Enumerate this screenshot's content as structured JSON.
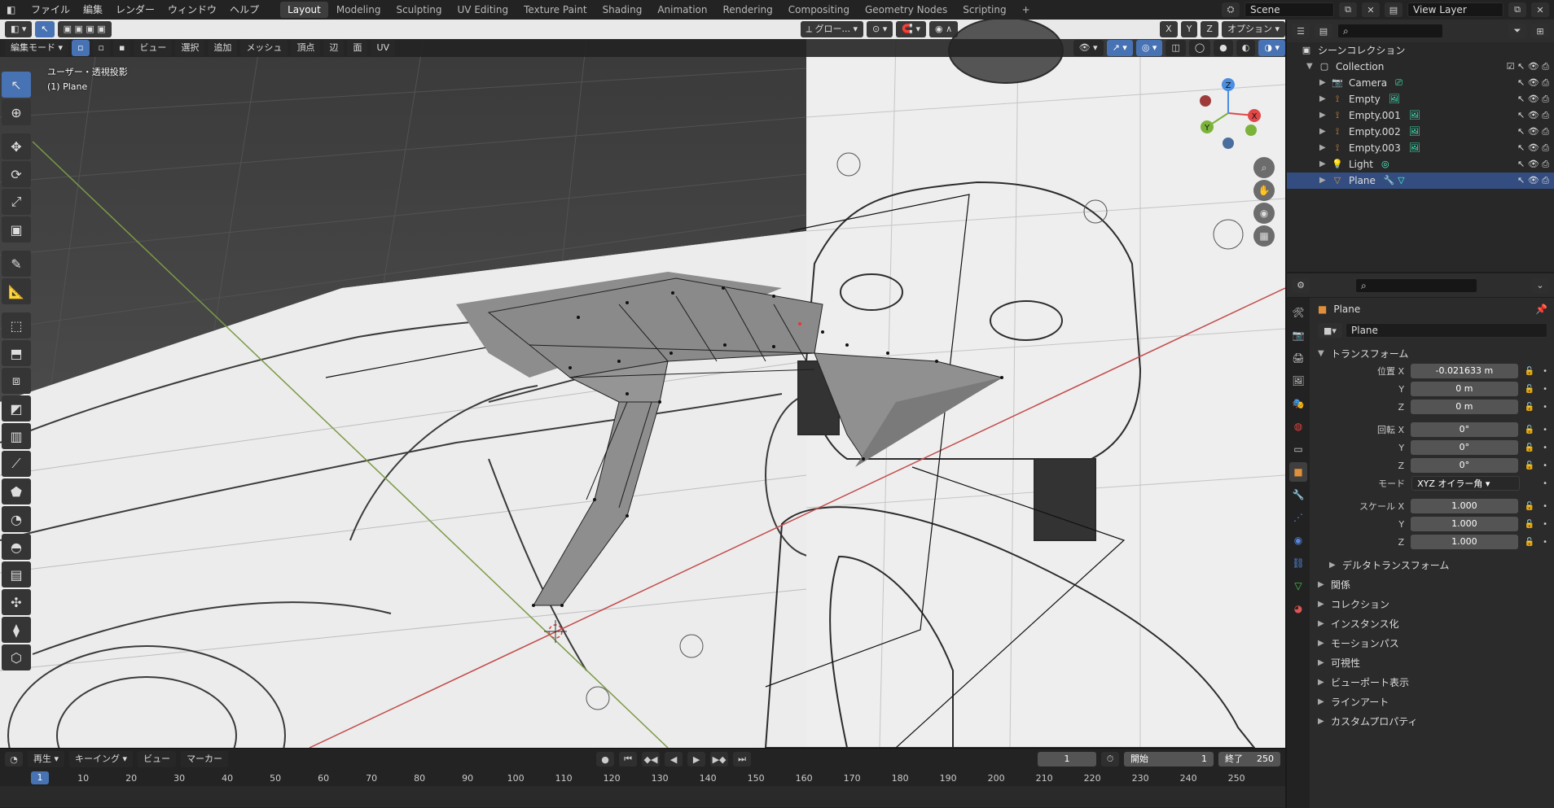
{
  "menubar": {
    "items": [
      "ファイル",
      "編集",
      "レンダー",
      "ウィンドウ",
      "ヘルプ"
    ],
    "workspaces": [
      "Layout",
      "Modeling",
      "Sculpting",
      "UV Editing",
      "Texture Paint",
      "Shading",
      "Animation",
      "Rendering",
      "Compositing",
      "Geometry Nodes",
      "Scripting"
    ],
    "active_workspace": "Layout",
    "scene": "Scene",
    "view_layer": "View Layer"
  },
  "viewport": {
    "mode": "編集モード",
    "menus": [
      "ビュー",
      "選択",
      "追加",
      "メッシュ",
      "頂点",
      "辺",
      "面",
      "UV"
    ],
    "transform_orientation": "グロー...",
    "axes": [
      "X",
      "Y",
      "Z"
    ],
    "options": "オプション",
    "overlay_line1": "ユーザー・透視投影",
    "overlay_line2": "(1) Plane",
    "gizmo_axes": [
      "X",
      "Y",
      "Z"
    ]
  },
  "outliner": {
    "root": "シーンコレクション",
    "collection": "Collection",
    "objects": [
      {
        "name": "Camera",
        "icon": "camera-icon",
        "color": "#e0903a"
      },
      {
        "name": "Empty",
        "icon": "empty-icon",
        "color": "#e0903a"
      },
      {
        "name": "Empty.001",
        "icon": "empty-icon",
        "color": "#e0903a"
      },
      {
        "name": "Empty.002",
        "icon": "empty-icon",
        "color": "#e0903a"
      },
      {
        "name": "Empty.003",
        "icon": "empty-icon",
        "color": "#e0903a"
      },
      {
        "name": "Light",
        "icon": "light-icon",
        "color": "#e0903a"
      },
      {
        "name": "Plane",
        "icon": "mesh-icon",
        "color": "#e0903a"
      }
    ],
    "selected": "Plane"
  },
  "properties": {
    "object_name": "Plane",
    "datablock": "Plane",
    "transform_label": "トランスフォーム",
    "location_label": "位置 X",
    "location": [
      "-0.021633 m",
      "0 m",
      "0 m"
    ],
    "rotation_label": "回転 X",
    "rotation": [
      "0°",
      "0°",
      "0°"
    ],
    "mode_label": "モード",
    "mode_value": "XYZ オイラー角",
    "scale_label": "スケール X",
    "scale": [
      "1.000",
      "1.000",
      "1.000"
    ],
    "axis_y": "Y",
    "axis_z": "Z",
    "delta": "デルタトランスフォーム",
    "sections": [
      "関係",
      "コレクション",
      "インスタンス化",
      "モーションパス",
      "可視性",
      "ビューポート表示",
      "ラインアート",
      "カスタムプロパティ"
    ]
  },
  "timeline": {
    "menus": [
      "再生",
      "キーイング",
      "ビュー",
      "マーカー"
    ],
    "current_frame": "1",
    "start_label": "開始",
    "start": "1",
    "end_label": "終了",
    "end": "250",
    "ticks": [
      "1",
      "10",
      "20",
      "30",
      "40",
      "50",
      "60",
      "70",
      "80",
      "90",
      "100",
      "110",
      "120",
      "130",
      "140",
      "150",
      "160",
      "170",
      "180",
      "190",
      "200",
      "210",
      "220",
      "230",
      "240",
      "250"
    ]
  }
}
